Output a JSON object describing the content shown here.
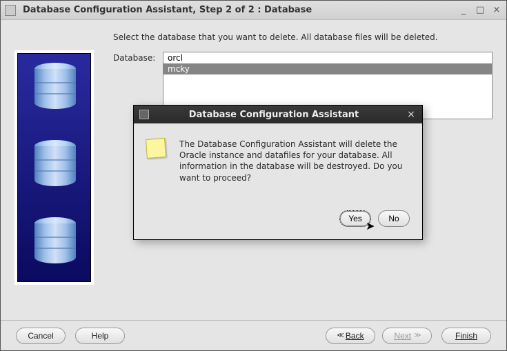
{
  "window": {
    "title": "Database Configuration Assistant, Step 2 of 2 : Database",
    "controls": {
      "minimize": "_",
      "maximize": "□",
      "close": "×"
    }
  },
  "main": {
    "instruction": "Select the database that you want to delete. All database files will be deleted.",
    "db_label": "Database:",
    "db_list": [
      "orcl",
      "mcky"
    ],
    "selected_index": 1
  },
  "modal": {
    "title": "Database Configuration Assistant",
    "message": "The Database Configuration Assistant will delete the Oracle instance and datafiles for your database. All information in the database will be destroyed. Do you want to proceed?",
    "yes": "Yes",
    "no": "No",
    "close": "×"
  },
  "footer": {
    "cancel": "Cancel",
    "help": "Help",
    "back": "Back",
    "next": "Next",
    "finish": "Finish"
  }
}
